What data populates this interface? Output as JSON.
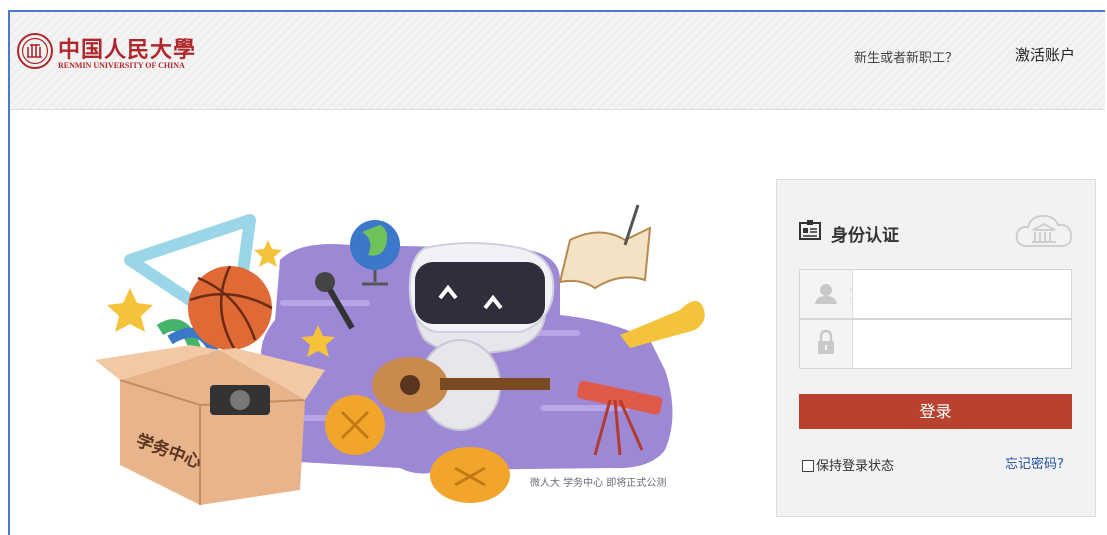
{
  "header": {
    "logo_cn": "中国人民大學",
    "logo_en": "RENMIN UNIVERSITY OF CHINA",
    "question": "新生或者新职工？",
    "activate_label": "激活账户"
  },
  "illustration": {
    "box_label": "学务中心",
    "caption": "微人大 学务中心 即将正式公测"
  },
  "login": {
    "title": "身份认证",
    "username": {
      "value": "",
      "placeholder": ""
    },
    "password": {
      "value": "",
      "placeholder": ""
    },
    "submit_label": "登录",
    "remember_label": "保持登录状态",
    "forgot_label": "忘记密码?"
  },
  "colors": {
    "brand_red": "#b0272b",
    "button_red": "#b9412f",
    "link_blue": "#1c4f9c",
    "frame_blue": "#4e78c8"
  },
  "icons": [
    "university-seal-icon",
    "id-card-icon",
    "cloud-building-icon",
    "user-icon",
    "lock-icon"
  ]
}
